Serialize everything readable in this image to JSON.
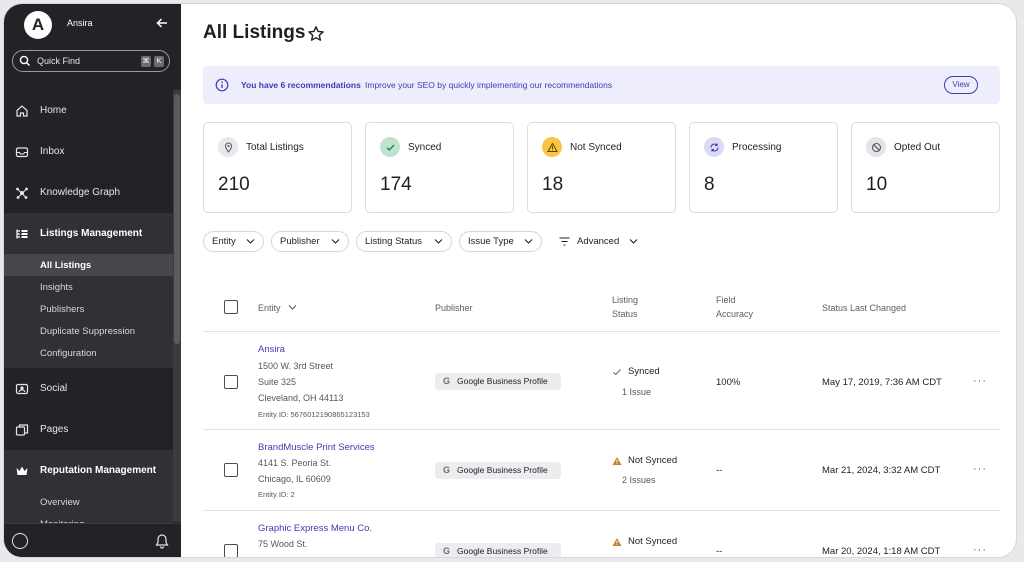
{
  "sidebar": {
    "logo_letter": "A",
    "org_name": "Ansira",
    "search_placeholder": "Quick Find",
    "shortcut_keys": [
      "⌘",
      "K"
    ],
    "nav": [
      {
        "label": "Home",
        "icon": "home-icon"
      },
      {
        "label": "Inbox",
        "icon": "inbox-icon"
      },
      {
        "label": "Knowledge Graph",
        "icon": "knowledge-graph-icon"
      }
    ],
    "listings_group": {
      "label": "Listings Management",
      "icon": "listings-icon",
      "items": [
        "All Listings",
        "Insights",
        "Publishers",
        "Duplicate Suppression",
        "Configuration"
      ],
      "active": "All Listings"
    },
    "nav_lower": [
      {
        "label": "Social",
        "icon": "social-icon"
      },
      {
        "label": "Pages",
        "icon": "pages-icon"
      }
    ],
    "reputation_group": {
      "label": "Reputation Management",
      "icon": "crown-icon",
      "items": [
        "Overview",
        "Monitoring"
      ]
    }
  },
  "header": {
    "title": "All Listings"
  },
  "banner": {
    "strong": "You have 6 recommendations",
    "text": "Improve your SEO by quickly implementing our recommendations",
    "button": "View"
  },
  "stats": [
    {
      "label": "Total Listings",
      "value": "210",
      "icon": "pin-icon",
      "color": "#e9e9ed"
    },
    {
      "label": "Synced",
      "value": "174",
      "icon": "check-icon",
      "color": "#bfe3cf"
    },
    {
      "label": "Not Synced",
      "value": "18",
      "icon": "warning-icon",
      "color": "#f6c543"
    },
    {
      "label": "Processing",
      "value": "8",
      "icon": "sync-icon",
      "color": "#dcdaf6"
    },
    {
      "label": "Opted Out",
      "value": "10",
      "icon": "blocked-icon",
      "color": "#e4e4e8"
    }
  ],
  "filters": [
    "Entity",
    "Publisher",
    "Listing Status",
    "Issue Type"
  ],
  "advanced_label": "Advanced",
  "table": {
    "headers": {
      "entity": "Entity",
      "publisher": "Publisher",
      "listing_status": [
        "Listing",
        "Status"
      ],
      "field_accuracy": [
        "Field",
        "Accuracy"
      ],
      "status_last_changed": "Status Last Changed"
    },
    "rows": [
      {
        "name": "Ansira",
        "address": [
          "1500 W. 3rd Street",
          "Suite 325",
          "Cleveland, OH 44113"
        ],
        "entity_id": "Entity ID: 5676012190865123153",
        "publisher": "Google Business Profile",
        "status": "Synced",
        "issues": "1 Issue",
        "accuracy": "100%",
        "changed": "May 17, 2019, 7:36 AM CDT"
      },
      {
        "name": "BrandMuscle Print Services",
        "address": [
          "4141 S. Peoria St.",
          "Chicago, IL 60609"
        ],
        "entity_id": "Entity ID: 2",
        "publisher": "Google Business Profile",
        "status": "Not Synced",
        "issues": "2 Issues",
        "accuracy": "--",
        "changed": "Mar 21, 2024, 3:32 AM CDT"
      },
      {
        "name": "Graphic Express Menu Co.",
        "address": [
          "75 Wood St."
        ],
        "entity_id": "",
        "publisher": "Google Business Profile",
        "status": "Not Synced",
        "issues": "",
        "accuracy": "--",
        "changed": "Mar 20, 2024, 1:18 AM CDT"
      }
    ],
    "more_glyph": "···"
  }
}
